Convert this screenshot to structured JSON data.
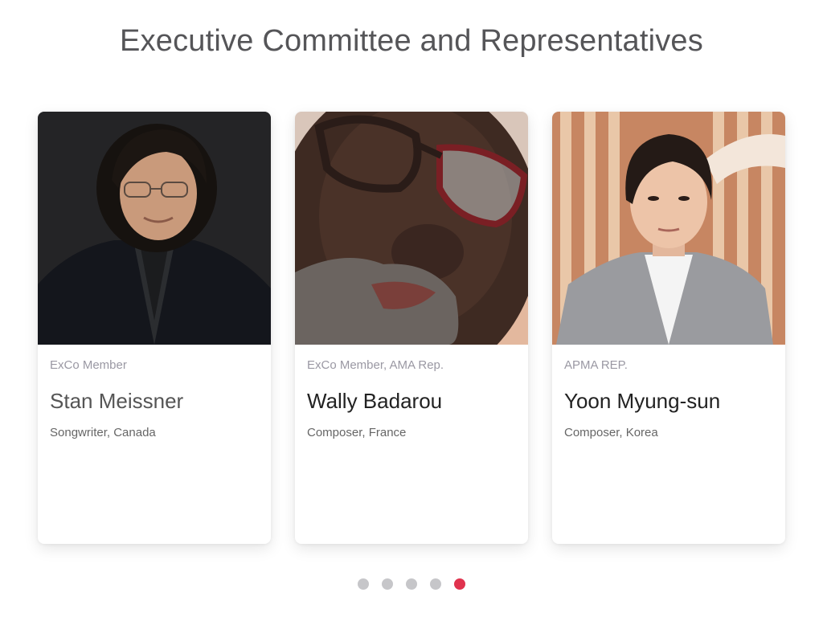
{
  "section": {
    "title": "Executive Committee and Representatives"
  },
  "cards": [
    {
      "role": "ExCo Member",
      "name": "Stan Meissner",
      "description": "Songwriter, Canada"
    },
    {
      "role": "ExCo Member, AMA Rep.",
      "name": "Wally Badarou",
      "description": "Composer, France"
    },
    {
      "role": "APMA REP.",
      "name": "Yoon Myung-sun",
      "description": "Composer, Korea"
    }
  ],
  "pagination": {
    "count": 5,
    "active_index": 4
  },
  "colors": {
    "accent": "#e0334e",
    "dot_inactive": "#c6c6c9",
    "title": "#555558"
  }
}
